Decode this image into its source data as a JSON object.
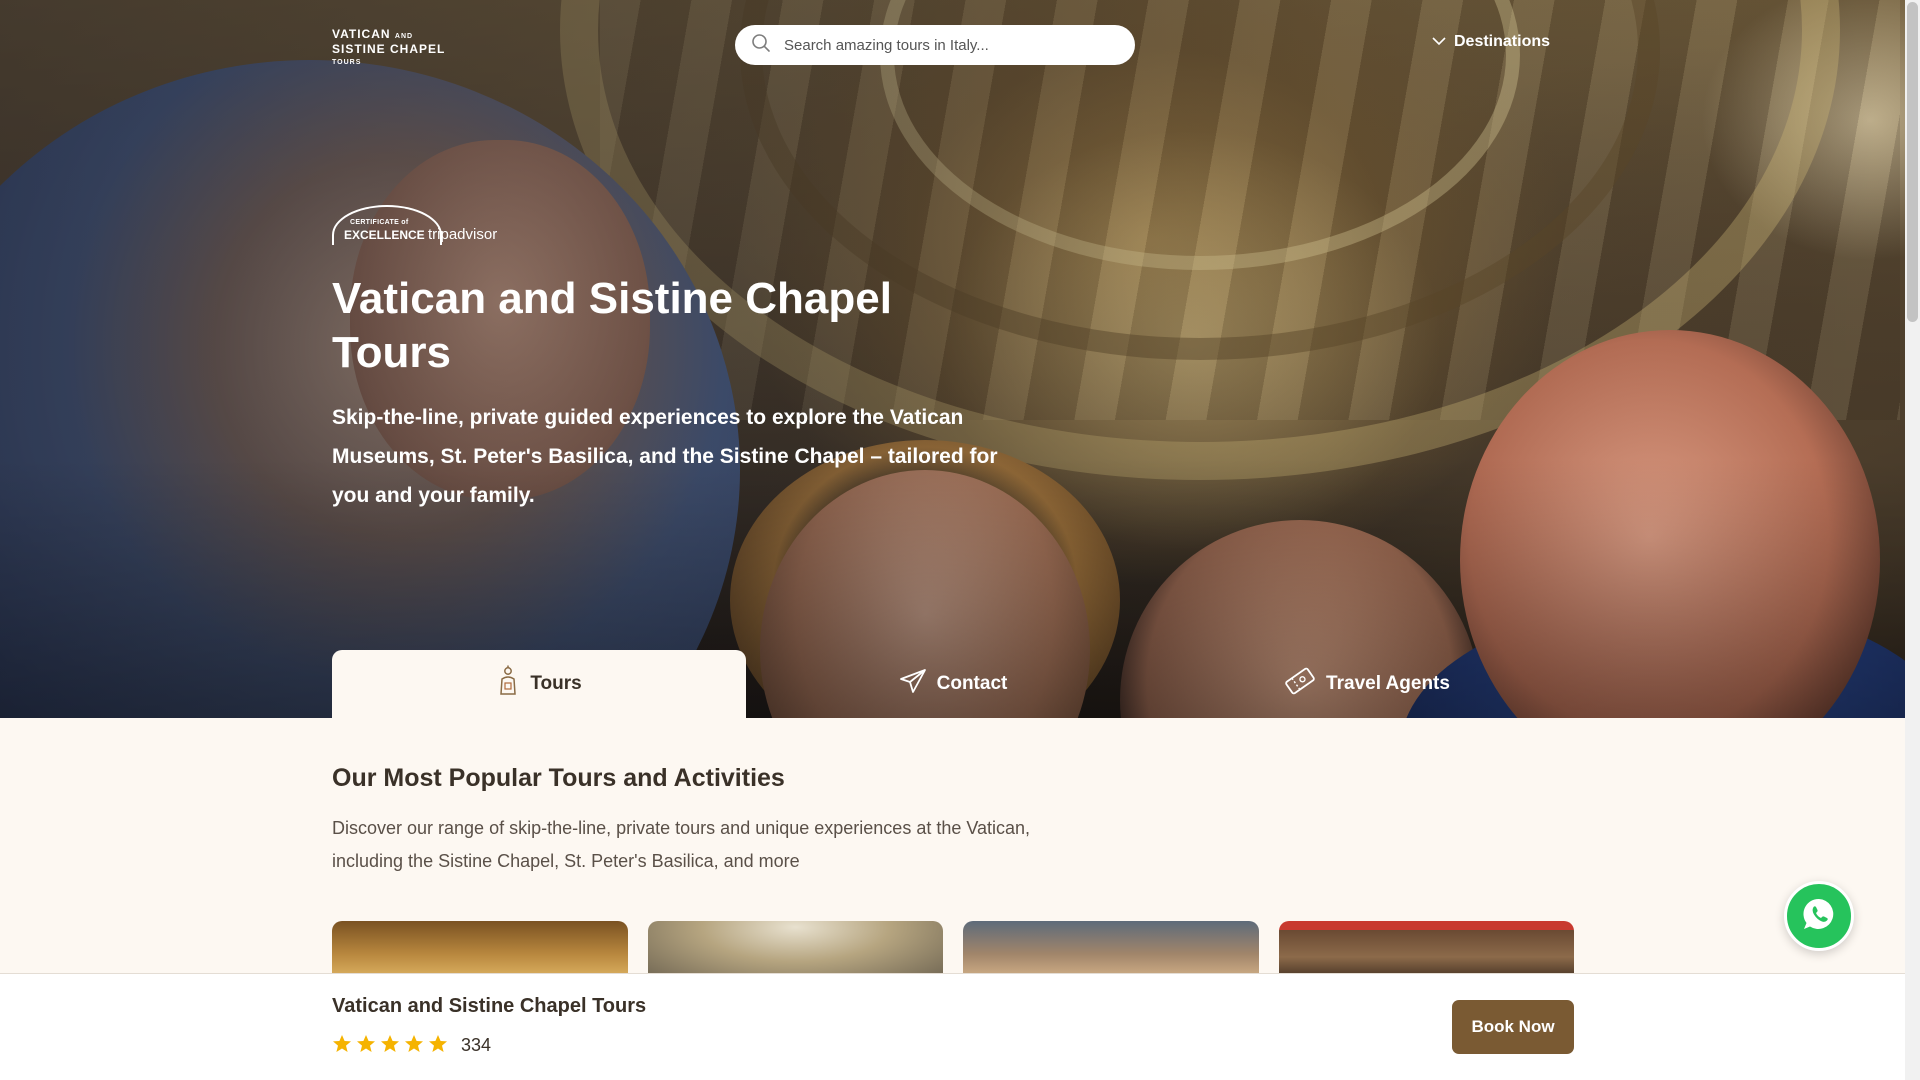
{
  "header": {
    "logo_line1": "Vatican",
    "logo_line1_small": "and",
    "logo_line2": "Sistine Chapel",
    "logo_line3": "Tours",
    "search_placeholder": "Search amazing tours in Italy...",
    "destinations_label": "Destinations"
  },
  "hero": {
    "certificate_line1": "CERTIFICATE of",
    "certificate_line2": "EXCELLENCE",
    "certificate_brand": "tripadvisor",
    "title": "Vatican and Sistine Chapel Tours",
    "subtitle": "Skip-the-line, private guided experiences to explore the Vatican Museums, St. Peter's Basilica, and the Sistine Chapel – tailored for you and your family."
  },
  "tabs": [
    {
      "label": "Tours",
      "icon": "tour-guide-icon",
      "active": true
    },
    {
      "label": "Contact",
      "icon": "paper-plane-icon",
      "active": false
    },
    {
      "label": "Travel Agents",
      "icon": "ticket-icon",
      "active": false
    }
  ],
  "section": {
    "title": "Our Most Popular Tours and Activities",
    "description": "Discover our range of skip-the-line, private tours and unique experiences at the Vatican, including the Sistine Chapel, St. Peter's Basilica, and more"
  },
  "bottom_bar": {
    "title": "Vatican and Sistine Chapel Tours",
    "rating_stars": 5,
    "review_count": "334",
    "book_label": "Book Now"
  },
  "colors": {
    "accent_brown": "#7a5a33",
    "cream_bg": "#fdf8f2",
    "star_yellow": "#f5b301",
    "whatsapp_green": "#26c35c"
  }
}
